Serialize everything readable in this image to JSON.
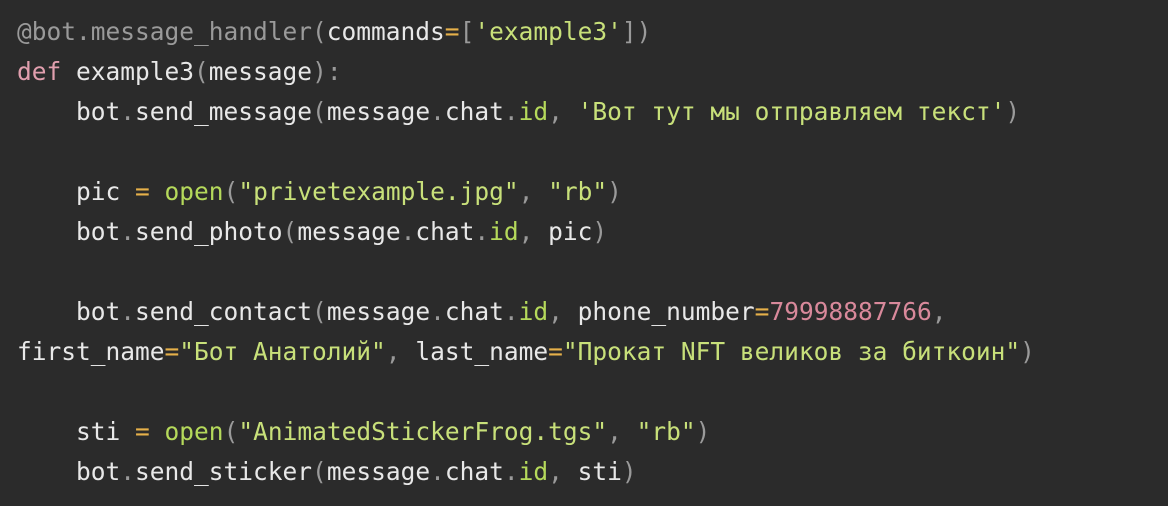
{
  "editor": {
    "language": "python",
    "colors": {
      "background": "#2b2b2b",
      "plain": "#e8e8e8",
      "keyword": "#e19fae",
      "punct": "#9a9a9a",
      "string": "#c8e07a",
      "attr": "#b5d95b",
      "operator": "#e6b04a",
      "number": "#d9899b"
    },
    "lines": [
      [
        {
          "t": "@bot.message_handler",
          "c": "punct"
        },
        {
          "t": "(",
          "c": "punct"
        },
        {
          "t": "commands",
          "c": "plain"
        },
        {
          "t": "=",
          "c": "operator"
        },
        {
          "t": "[",
          "c": "punct"
        },
        {
          "t": "'example3'",
          "c": "string"
        },
        {
          "t": "])",
          "c": "punct"
        }
      ],
      [
        {
          "t": "def",
          "c": "keyword"
        },
        {
          "t": " example3",
          "c": "plain"
        },
        {
          "t": "(",
          "c": "punct"
        },
        {
          "t": "message",
          "c": "plain"
        },
        {
          "t": "):",
          "c": "punct"
        }
      ],
      [
        {
          "t": "    bot",
          "c": "plain"
        },
        {
          "t": ".",
          "c": "punct"
        },
        {
          "t": "send_message",
          "c": "plain"
        },
        {
          "t": "(",
          "c": "punct"
        },
        {
          "t": "message",
          "c": "plain"
        },
        {
          "t": ".",
          "c": "punct"
        },
        {
          "t": "chat",
          "c": "plain"
        },
        {
          "t": ".",
          "c": "punct"
        },
        {
          "t": "id",
          "c": "attr"
        },
        {
          "t": ", ",
          "c": "punct"
        },
        {
          "t": "'Вот тут мы отправляем текст'",
          "c": "string"
        },
        {
          "t": ")",
          "c": "punct"
        }
      ],
      [],
      [
        {
          "t": "    pic ",
          "c": "plain"
        },
        {
          "t": "=",
          "c": "operator"
        },
        {
          "t": " ",
          "c": "plain"
        },
        {
          "t": "open",
          "c": "attr"
        },
        {
          "t": "(",
          "c": "punct"
        },
        {
          "t": "\"privetexample.jpg\"",
          "c": "string"
        },
        {
          "t": ", ",
          "c": "punct"
        },
        {
          "t": "\"rb\"",
          "c": "string"
        },
        {
          "t": ")",
          "c": "punct"
        }
      ],
      [
        {
          "t": "    bot",
          "c": "plain"
        },
        {
          "t": ".",
          "c": "punct"
        },
        {
          "t": "send_photo",
          "c": "plain"
        },
        {
          "t": "(",
          "c": "punct"
        },
        {
          "t": "message",
          "c": "plain"
        },
        {
          "t": ".",
          "c": "punct"
        },
        {
          "t": "chat",
          "c": "plain"
        },
        {
          "t": ".",
          "c": "punct"
        },
        {
          "t": "id",
          "c": "attr"
        },
        {
          "t": ", ",
          "c": "punct"
        },
        {
          "t": "pic",
          "c": "plain"
        },
        {
          "t": ")",
          "c": "punct"
        }
      ],
      [],
      [
        {
          "t": "    bot",
          "c": "plain"
        },
        {
          "t": ".",
          "c": "punct"
        },
        {
          "t": "send_contact",
          "c": "plain"
        },
        {
          "t": "(",
          "c": "punct"
        },
        {
          "t": "message",
          "c": "plain"
        },
        {
          "t": ".",
          "c": "punct"
        },
        {
          "t": "chat",
          "c": "plain"
        },
        {
          "t": ".",
          "c": "punct"
        },
        {
          "t": "id",
          "c": "attr"
        },
        {
          "t": ", ",
          "c": "punct"
        },
        {
          "t": "phone_number",
          "c": "plain"
        },
        {
          "t": "=",
          "c": "operator"
        },
        {
          "t": "79998887766",
          "c": "number"
        },
        {
          "t": ",",
          "c": "punct"
        }
      ],
      [
        {
          "t": "first_name",
          "c": "plain"
        },
        {
          "t": "=",
          "c": "operator"
        },
        {
          "t": "\"Бот Анатолий\"",
          "c": "string"
        },
        {
          "t": ", ",
          "c": "punct"
        },
        {
          "t": "last_name",
          "c": "plain"
        },
        {
          "t": "=",
          "c": "operator"
        },
        {
          "t": "\"Прокат NFT великов за биткоин\"",
          "c": "string"
        },
        {
          "t": ")",
          "c": "punct"
        }
      ],
      [],
      [
        {
          "t": "    sti ",
          "c": "plain"
        },
        {
          "t": "=",
          "c": "operator"
        },
        {
          "t": " ",
          "c": "plain"
        },
        {
          "t": "open",
          "c": "attr"
        },
        {
          "t": "(",
          "c": "punct"
        },
        {
          "t": "\"AnimatedStickerFrog.tgs\"",
          "c": "string"
        },
        {
          "t": ", ",
          "c": "punct"
        },
        {
          "t": "\"rb\"",
          "c": "string"
        },
        {
          "t": ")",
          "c": "punct"
        }
      ],
      [
        {
          "t": "    bot",
          "c": "plain"
        },
        {
          "t": ".",
          "c": "punct"
        },
        {
          "t": "send_sticker",
          "c": "plain"
        },
        {
          "t": "(",
          "c": "punct"
        },
        {
          "t": "message",
          "c": "plain"
        },
        {
          "t": ".",
          "c": "punct"
        },
        {
          "t": "chat",
          "c": "plain"
        },
        {
          "t": ".",
          "c": "punct"
        },
        {
          "t": "id",
          "c": "attr"
        },
        {
          "t": ", ",
          "c": "punct"
        },
        {
          "t": "sti",
          "c": "plain"
        },
        {
          "t": ")",
          "c": "punct"
        }
      ]
    ]
  }
}
